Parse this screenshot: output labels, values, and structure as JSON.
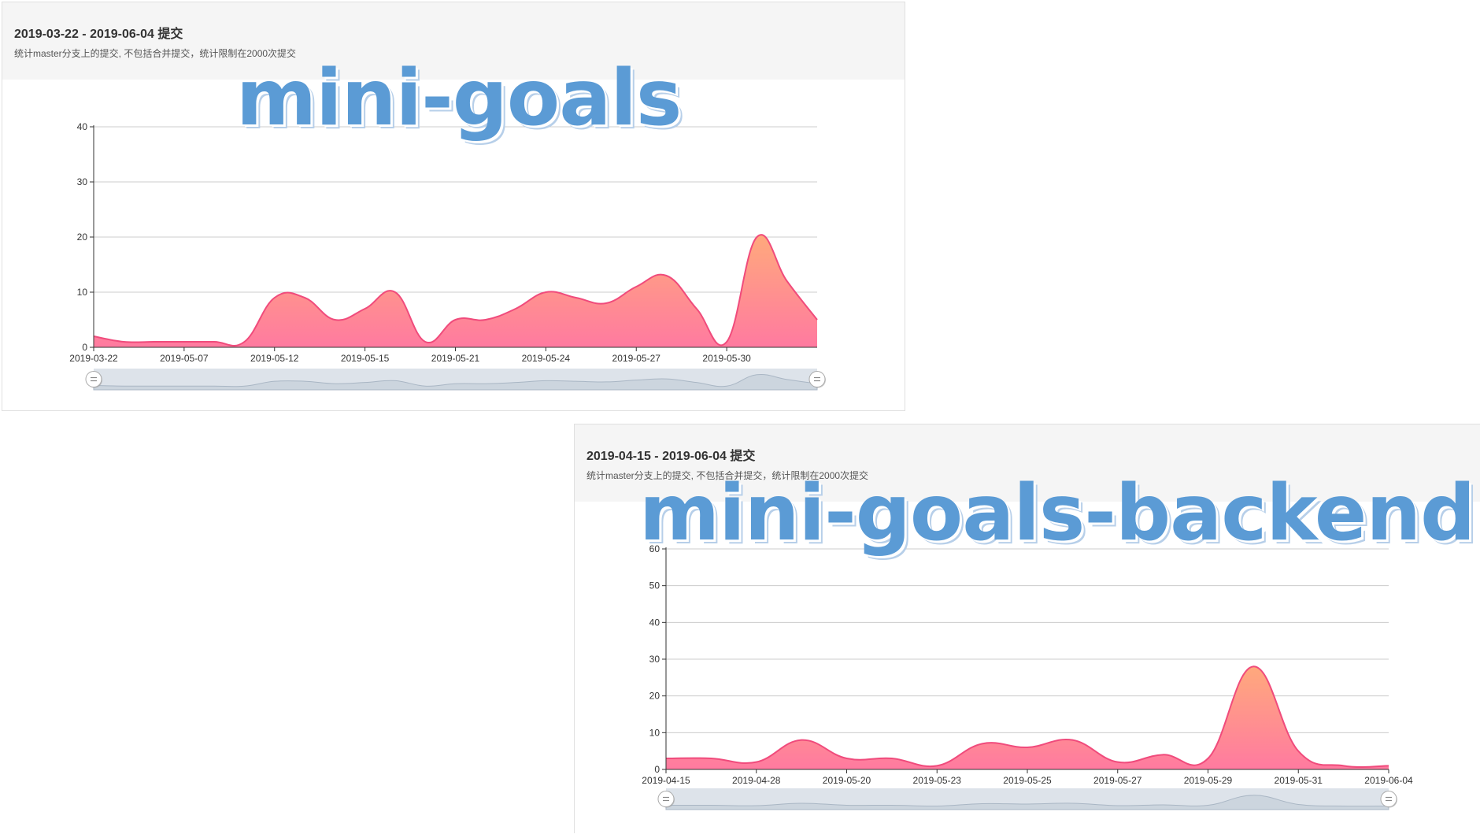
{
  "panels": [
    {
      "title": "2019-03-22 - 2019-06-04 提交",
      "subtitle": "统计master分支上的提交, 不包括合并提交，统计限制在2000次提交",
      "watermark": "mini-goals"
    },
    {
      "title": "2019-04-15 - 2019-06-04 提交",
      "subtitle": "统计master分支上的提交, 不包括合并提交，统计限制在2000次提交",
      "watermark": "mini-goals-backend"
    }
  ],
  "colors": {
    "line": "#f04b7c",
    "fill_top": "#ffa97c",
    "fill_bottom": "#ff7aa0",
    "grid": "#cccccc",
    "axis": "#333333",
    "zoom_bg": "#dde3ea",
    "zoom_shadow": "#b9c4d0"
  },
  "chart_data": [
    {
      "type": "area",
      "smooth": true,
      "x": [
        "2019-03-22",
        "",
        "2019-05-07",
        "",
        "2019-05-12",
        "",
        "2019-05-15",
        "",
        "2019-05-21",
        "",
        "2019-05-24",
        "",
        "2019-05-27",
        "",
        "2019-05-30",
        "",
        ""
      ],
      "xticks": [
        "2019-03-22",
        "2019-05-07",
        "2019-05-12",
        "2019-05-15",
        "2019-05-21",
        "2019-05-24",
        "2019-05-27",
        "2019-05-30"
      ],
      "values": [
        2,
        1,
        1,
        1,
        1,
        1,
        9,
        9,
        5,
        7,
        10,
        1,
        5,
        5,
        7,
        10,
        9,
        8,
        11,
        13,
        7,
        1,
        20,
        12,
        5
      ],
      "ylim": [
        0,
        40
      ],
      "yticks": [
        0,
        10,
        20,
        30,
        40
      ],
      "grid": true,
      "dataZoom": true
    },
    {
      "type": "area",
      "smooth": true,
      "xticks": [
        "2019-04-15",
        "2019-04-28",
        "2019-05-20",
        "2019-05-23",
        "2019-05-25",
        "2019-05-27",
        "2019-05-29",
        "2019-05-31",
        "2019-06-04"
      ],
      "values": [
        3,
        3,
        2,
        8,
        3,
        3,
        1,
        7,
        6,
        8,
        2,
        4,
        3,
        28,
        5,
        1,
        1
      ],
      "ylim": [
        0,
        60
      ],
      "yticks": [
        0,
        10,
        20,
        30,
        40,
        50,
        60
      ],
      "grid": true,
      "dataZoom": true
    }
  ]
}
